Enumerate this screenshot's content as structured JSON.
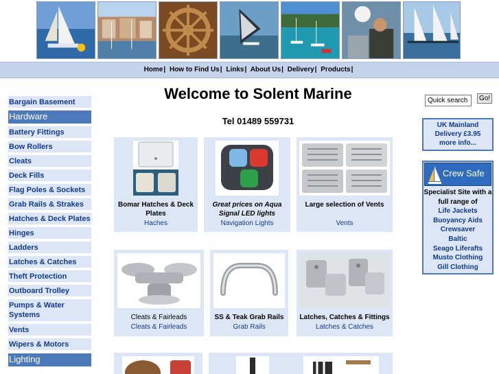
{
  "banner": {
    "photos": [
      "sailing-race-photo",
      "marina-apartments-photo",
      "ships-wheel-photo",
      "windsurfer-photo",
      "anchored-yachts-photo",
      "sailor-at-winch-photo",
      "yacht-racing-fleet-photo"
    ]
  },
  "nav": {
    "items": [
      {
        "label": "Home"
      },
      {
        "label": "How to Find Us"
      },
      {
        "label": "Links"
      },
      {
        "label": "About Us"
      },
      {
        "label": "Delivery"
      },
      {
        "label": "Products"
      }
    ],
    "separator": "|"
  },
  "sidebar": {
    "items": [
      {
        "label": "Bargain Basement",
        "type": "link"
      },
      {
        "label": "Hardware",
        "type": "heading"
      },
      {
        "label": "Battery Fittings",
        "type": "link"
      },
      {
        "label": "Bow Rollers",
        "type": "link"
      },
      {
        "label": "Cleats",
        "type": "link"
      },
      {
        "label": "Deck Fills",
        "type": "link"
      },
      {
        "label": "Flag Poles & Sockets",
        "type": "link"
      },
      {
        "label": "Grab Rails & Strakes",
        "type": "link"
      },
      {
        "label": "Hatches & Deck Plates",
        "type": "link"
      },
      {
        "label": "Hinges",
        "type": "link"
      },
      {
        "label": "Ladders",
        "type": "link"
      },
      {
        "label": "Latches & Catches",
        "type": "link"
      },
      {
        "label": "Theft Protection",
        "type": "link"
      },
      {
        "label": "Outboard Trolley",
        "type": "link"
      },
      {
        "label": "Pumps & Water Systems",
        "type": "link"
      },
      {
        "label": "Vents",
        "type": "link"
      },
      {
        "label": "Wipers & Motors",
        "type": "link"
      },
      {
        "label": "Lighting",
        "type": "heading"
      }
    ]
  },
  "main": {
    "title": "Welcome to Solent Marine",
    "phone": "Tel 01489 559731",
    "cards": [
      {
        "caption": "Bomar Hatches & Deck Plates",
        "link": "Haches",
        "image": "hatch-photo"
      },
      {
        "caption": "Great prices on Aqua Signal LED lights",
        "link": "Navigation Lights",
        "image": "navigation-light-photo"
      },
      {
        "caption": "Large selection of Vents",
        "link": "Vents",
        "image": "vents-photo"
      },
      {
        "caption": "Cleats & Fairleads",
        "link": "Cleats & Fairleads",
        "image": "cleat-photo"
      },
      {
        "caption": "SS & Teak Grab Rails",
        "link": "Grab Rails",
        "image": "grab-rail-photo"
      },
      {
        "caption": "Latches, Catches & Fittings",
        "link": "Latches & Catches",
        "image": "latch-photo"
      }
    ]
  },
  "right": {
    "search": {
      "value": "Quick search",
      "button": "Go!"
    },
    "delivery": {
      "line1": "UK Mainland",
      "line2": "Delivery £3.95",
      "line3": "more info..."
    },
    "crewsafe": {
      "logo": "Crew Safe",
      "intro": "Specialist Site with a full range of",
      "links": [
        "Life Jackets",
        "Buoyancy Aids",
        "Crewsaver",
        "Baltic",
        "Seago Liferafts",
        "Musto Clothing",
        "Gill Clothing"
      ]
    }
  },
  "colors": {
    "accent": "#4c79b9",
    "panel": "#dde6f6",
    "navbar": "#c5d3ec",
    "link": "#123a8e"
  }
}
